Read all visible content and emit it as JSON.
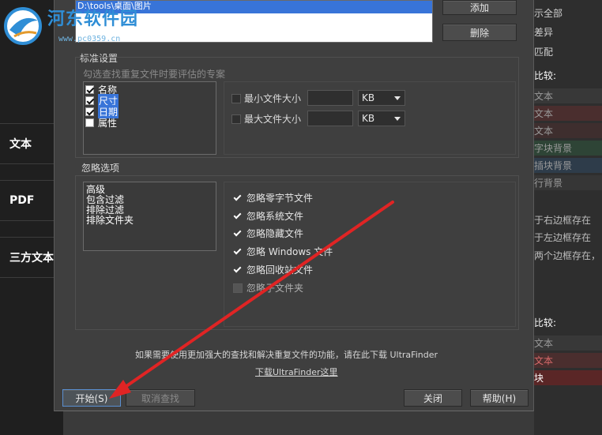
{
  "watermark": {
    "title": "河东软件园",
    "url": "www.pc0359.cn"
  },
  "left_panel": {
    "items": [
      "文本",
      "PDF",
      "三方文本"
    ]
  },
  "right_panel": {
    "lines_top": [
      "示全部",
      "差异",
      "匹配"
    ],
    "heading1": "比较:",
    "rows1": [
      "文本",
      "文本",
      "文本",
      "字块背景",
      "插块背景",
      "行背景"
    ],
    "lines_mid": [
      "于右边框存在",
      "于左边框存在",
      "两个边框存在，"
    ],
    "heading2": "比较:",
    "rows2": [
      "文本",
      "文本",
      "块"
    ]
  },
  "dialog": {
    "path_list": {
      "selected_path": "D:\\tools\\桌面\\图片"
    },
    "add_button": "添加",
    "delete_button": "删除",
    "standard": {
      "title": "标准设置",
      "hint": "勾选查找重复文件时要评估的专案",
      "criteria": [
        {
          "label": "名称",
          "checked": true,
          "selected": false
        },
        {
          "label": "尺寸",
          "checked": true,
          "selected": true
        },
        {
          "label": "日期",
          "checked": true,
          "selected": true
        },
        {
          "label": "属性",
          "checked": false,
          "selected": false
        }
      ],
      "min_size_label": "最小文件大小",
      "max_size_label": "最大文件大小",
      "min_unit": "KB",
      "max_unit": "KB"
    },
    "ignore": {
      "title": "忽略选项",
      "list": [
        "高级",
        "包含过滤",
        "排除过滤",
        "排除文件夹"
      ],
      "options": [
        {
          "label": "忽略零字节文件",
          "checked": true
        },
        {
          "label": "忽略系统文件",
          "checked": true
        },
        {
          "label": "忽略隐藏文件",
          "checked": true
        },
        {
          "label": "忽略 Windows 文件",
          "checked": true
        },
        {
          "label": "忽略回收站文件",
          "checked": true
        },
        {
          "label": "忽略子文件夹",
          "checked": false
        }
      ]
    },
    "info_text": "如果需要使用更加强大的查找和解决重复文件的功能，请在此下载 UltraFinder",
    "info_link": "下载UltraFinder这里",
    "start_button": "开始(S)",
    "cancel_search_button": "取消查找",
    "close_button": "关闭",
    "help_button": "帮助(H)"
  },
  "colors": {
    "arrow": "#e02424",
    "selection": "#3874d8",
    "watermark": "#2f8ed6"
  }
}
